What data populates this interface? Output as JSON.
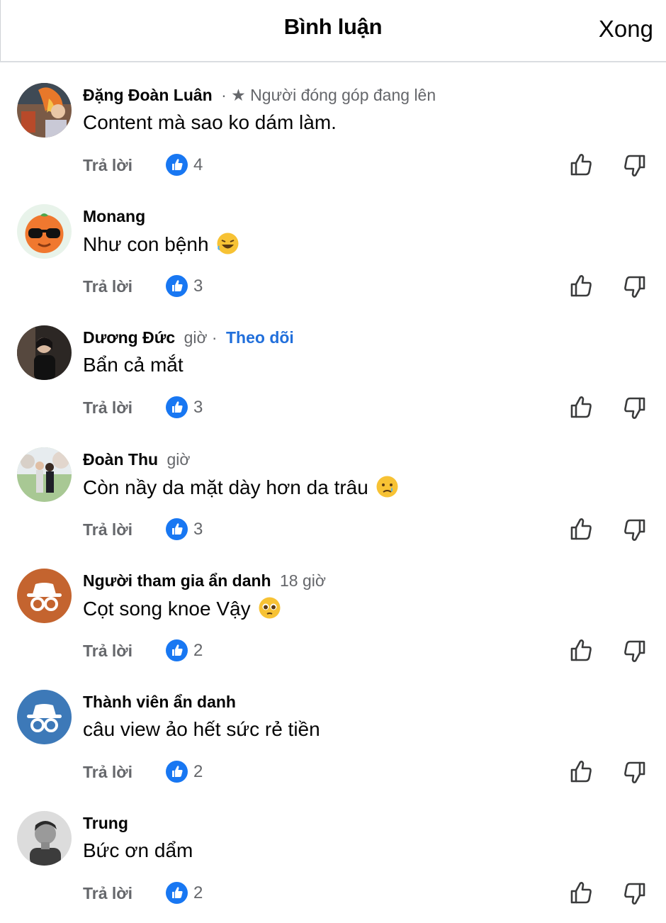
{
  "header": {
    "title": "Bình luận",
    "done_label": "Xong"
  },
  "comments": [
    {
      "name": "Đặng Đoàn Luân",
      "meta": "· ★ Người đóng góp đang lên",
      "text": "Content mà sao ko dám làm.",
      "emoji": "",
      "reply_label": "Trả lời",
      "likes": "4",
      "avatar": "photo-fire"
    },
    {
      "name": "Monang",
      "meta": "",
      "text": "Như con bệnh",
      "emoji": "rofl-emoji",
      "reply_label": "Trả lời",
      "likes": "3",
      "avatar": "orange-sunglasses"
    },
    {
      "name": "Dương Đức",
      "meta": "giờ ·",
      "follow": "Theo dõi",
      "text": "Bẩn cả mắt",
      "emoji": "",
      "reply_label": "Trả lời",
      "likes": "3",
      "avatar": "photo-dark"
    },
    {
      "name": "Đoàn Thu",
      "meta": "giờ",
      "text": "Còn nầy da mặt dày hơn da trâu",
      "emoji": "tear-emoji",
      "reply_label": "Trả lời",
      "likes": "3",
      "avatar": "photo-couple"
    },
    {
      "name": "Người tham gia ẩn danh",
      "meta": "18 giờ",
      "text": "Cọt song knoe Vậy",
      "emoji": "pleading-emoji",
      "reply_label": "Trả lời",
      "likes": "2",
      "avatar": "anon-orange"
    },
    {
      "name": "Thành viên ẩn danh",
      "meta": "",
      "text": "câu view ảo hết sức rẻ tiền",
      "emoji": "",
      "reply_label": "Trả lời",
      "likes": "2",
      "avatar": "anon-blue"
    },
    {
      "name": "Trung",
      "meta": "",
      "text": "Bức ơn dẩm",
      "emoji": "",
      "reply_label": "Trả lời",
      "likes": "2",
      "avatar": "photo-bw"
    }
  ],
  "colors": {
    "accent": "#1877f2",
    "follow": "#216fdb",
    "muted": "#65676b"
  }
}
